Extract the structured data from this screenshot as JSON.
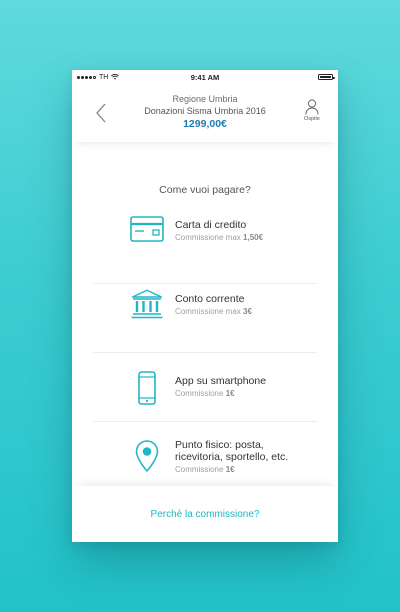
{
  "status_bar": {
    "carrier": "TH",
    "time": "9:41 AM"
  },
  "header": {
    "region": "Regione Umbria",
    "campaign": "Donazioni Sisma Umbria 2016",
    "amount": "1299,00€",
    "guest_label": "Ospite"
  },
  "question": "Come vuoi pagare?",
  "options": [
    {
      "icon": "credit-card-icon",
      "name": "Carta di credito",
      "commission_label": "Commissione max",
      "commission_value": "1,50€"
    },
    {
      "icon": "bank-icon",
      "name": "Conto corrente",
      "commission_label": "Commissione max",
      "commission_value": "3€"
    },
    {
      "icon": "smartphone-icon",
      "name": "App su smartphone",
      "commission_label": "Commissione",
      "commission_value": "1€"
    },
    {
      "icon": "location-pin-icon",
      "name_line1": "Punto fisico: posta,",
      "name_line2": "ricevitoria, sportello, etc.",
      "commission_label": "Commissione",
      "commission_value": "1€"
    }
  ],
  "footer": {
    "link": "Perchè la commissione?"
  },
  "colors": {
    "accent": "#1fb7c5",
    "amount": "#1a7db5",
    "background": "#3ccdd2"
  }
}
